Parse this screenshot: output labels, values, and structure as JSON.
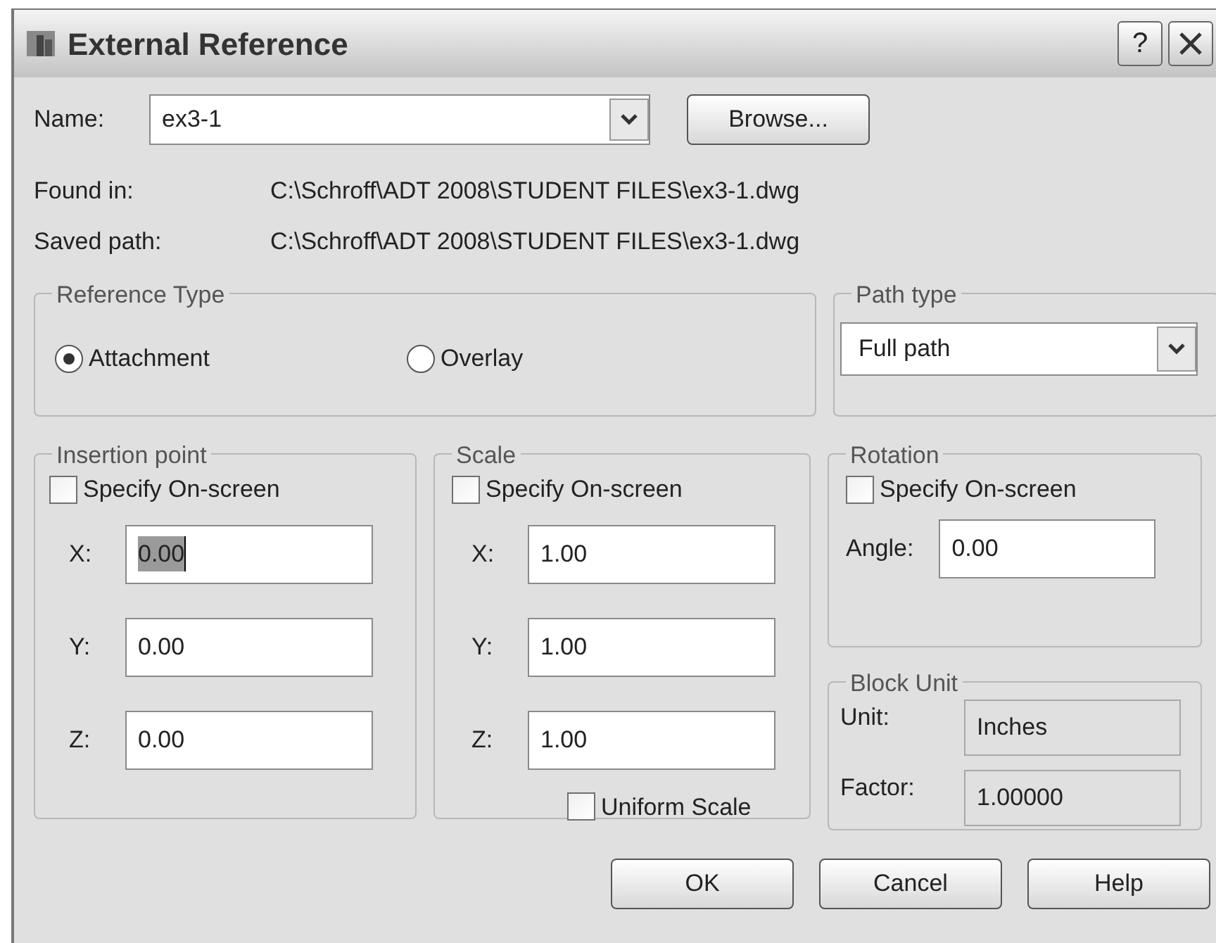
{
  "window": {
    "title": "External Reference"
  },
  "title_buttons": [
    {
      "kind": "help",
      "label": "?"
    },
    {
      "kind": "close"
    }
  ],
  "name": {
    "label": "Name:",
    "value": "ex3-1"
  },
  "browse_button": "Browse...",
  "found_in": {
    "label": "Found in:",
    "value": "C:\\Schroff\\ADT 2008\\STUDENT FILES\\ex3-1.dwg"
  },
  "saved_path": {
    "label": "Saved path:",
    "value": "C:\\Schroff\\ADT 2008\\STUDENT FILES\\ex3-1.dwg"
  },
  "reference_type": {
    "title": "Reference Type",
    "options": [
      {
        "label": "Attachment",
        "selected": true
      },
      {
        "label": "Overlay",
        "selected": false
      }
    ]
  },
  "path_type": {
    "title": "Path type",
    "value": "Full path"
  },
  "insertion_point": {
    "title": "Insertion point",
    "specify_on_screen": {
      "label": "Specify On-screen",
      "checked": false
    },
    "fields": [
      {
        "label": "X:",
        "value": "0.00",
        "text_selected": true
      },
      {
        "label": "Y:",
        "value": "0.00",
        "text_selected": false
      },
      {
        "label": "Z:",
        "value": "0.00",
        "text_selected": false
      }
    ]
  },
  "scale": {
    "title": "Scale",
    "specify_on_screen": {
      "label": "Specify On-screen",
      "checked": false
    },
    "fields": [
      {
        "label": "X:",
        "value": "1.00",
        "text_selected": false
      },
      {
        "label": "Y:",
        "value": "1.00",
        "text_selected": false
      },
      {
        "label": "Z:",
        "value": "1.00",
        "text_selected": false
      }
    ],
    "uniform_scale": {
      "label": "Uniform Scale",
      "checked": false
    }
  },
  "rotation": {
    "title": "Rotation",
    "specify_on_screen": {
      "label": "Specify On-screen",
      "checked": false
    },
    "angle": {
      "label": "Angle:",
      "value": "0.00"
    }
  },
  "block_unit": {
    "title": "Block Unit",
    "unit": {
      "label": "Unit:",
      "value": "Inches"
    },
    "factor": {
      "label": "Factor:",
      "value": "1.00000"
    }
  },
  "buttons": [
    "OK",
    "Cancel",
    "Help"
  ]
}
